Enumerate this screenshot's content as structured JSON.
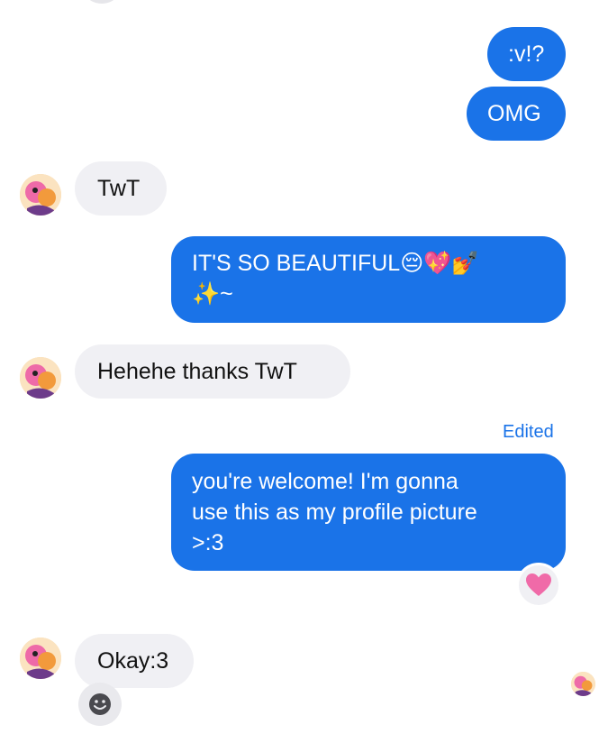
{
  "messages": [
    {
      "id": "m1",
      "side": "out",
      "text": ":v!?"
    },
    {
      "id": "m2",
      "side": "out",
      "text": "OMG"
    },
    {
      "id": "m3",
      "side": "in",
      "text": "TwT"
    },
    {
      "id": "m4",
      "side": "out",
      "text": "IT'S SO BEAUTIFUL😔💖💅\n✨~"
    },
    {
      "id": "m5",
      "side": "in",
      "text": "Hehehe thanks TwT"
    },
    {
      "id": "m6",
      "side": "out",
      "text": "you're welcome! I'm gonna\nuse this as my profile picture\n>:3",
      "status": "Edited",
      "reaction": "heart"
    },
    {
      "id": "m7",
      "side": "in",
      "text": "Okay:3"
    }
  ],
  "labels": {
    "edited": "Edited"
  },
  "icons": {
    "reaction": "heart-icon",
    "add_reaction": "smiley-icon",
    "avatar": "contact-avatar",
    "seen": "seen-avatar"
  },
  "colors": {
    "outgoing": "#1a73e8",
    "incoming": "#f0f0f4",
    "heart": "#f06aa8"
  }
}
